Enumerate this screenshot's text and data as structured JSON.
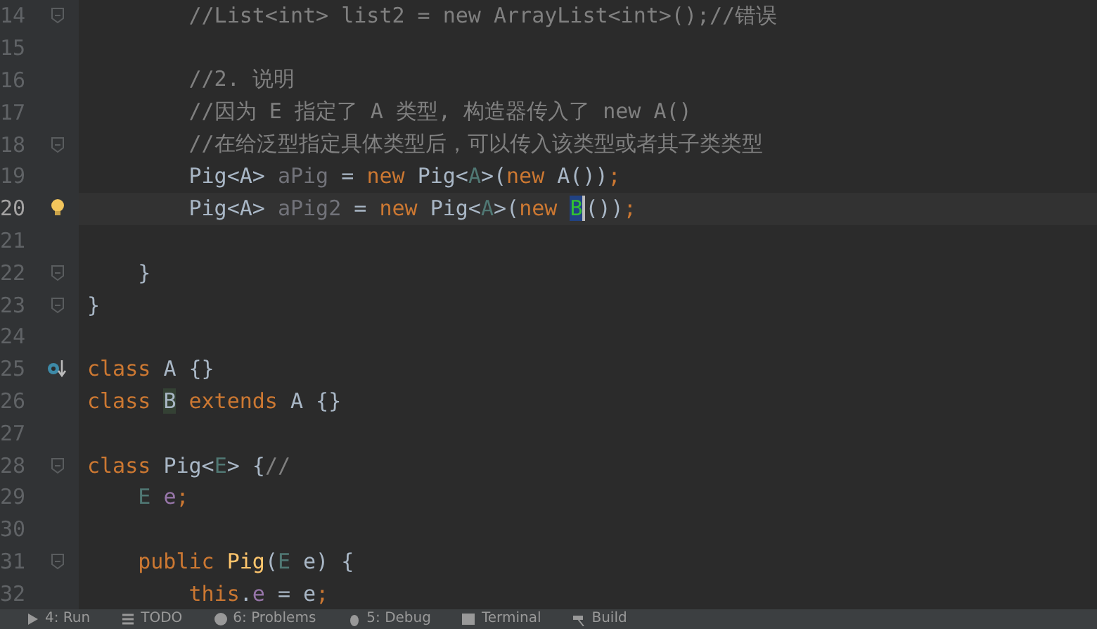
{
  "editor": {
    "lines": [
      {
        "number": "14",
        "current": false,
        "kind": "fold",
        "tokens": [
          {
            "text": "        //List<int> list2 = new ArrayList<int>();//错误",
            "kind": "comment"
          }
        ]
      },
      {
        "number": "15",
        "current": false
      },
      {
        "number": "16",
        "current": false,
        "tokens": [
          {
            "text": "        //2. 说明",
            "kind": "comment"
          }
        ]
      },
      {
        "number": "17",
        "current": false,
        "tokens": [
          {
            "text": "        //因为 E 指定了 A 类型, 构造器传入了 new A()",
            "kind": "comment"
          }
        ]
      },
      {
        "number": "18",
        "current": false,
        "kind": "fold",
        "tokens": [
          {
            "text": "        //在给泛型指定具体类型后，可以传入该类型或者其子类类型",
            "kind": "comment"
          }
        ]
      },
      {
        "number": "19",
        "current": false,
        "tokens": [
          {
            "text": "        Pig<A> ",
            "kind": "plain"
          },
          {
            "text": "aPig",
            "kind": "unused"
          },
          {
            "text": " = ",
            "kind": "plain"
          },
          {
            "text": "new ",
            "kind": "keyword"
          },
          {
            "text": "Pig<",
            "kind": "plain"
          },
          {
            "text": "A",
            "kind": "typeparam"
          },
          {
            "text": ">(",
            "kind": "plain"
          },
          {
            "text": "new ",
            "kind": "keyword"
          },
          {
            "text": "A())",
            "kind": "plain"
          },
          {
            "text": ";",
            "kind": "keyword"
          }
        ]
      },
      {
        "number": "20",
        "current": true,
        "kind": "bulb",
        "tokens": [
          {
            "text": "        Pig<A> ",
            "kind": "plain"
          },
          {
            "text": "aPig2",
            "kind": "unused"
          },
          {
            "text": " = ",
            "kind": "plain"
          },
          {
            "text": "new ",
            "kind": "keyword"
          },
          {
            "text": "Pig<",
            "kind": "plain"
          },
          {
            "text": "A",
            "kind": "typeparam"
          },
          {
            "text": ">(",
            "kind": "plain"
          },
          {
            "text": "new ",
            "kind": "keyword"
          },
          {
            "text": "B",
            "kind": "selected"
          },
          {
            "text": "())",
            "kind": "plain"
          },
          {
            "text": ";",
            "kind": "keyword"
          }
        ]
      },
      {
        "number": "21",
        "current": false
      },
      {
        "number": "22",
        "current": false,
        "kind": "fold",
        "tokens": [
          {
            "text": "    }",
            "kind": "plain"
          }
        ]
      },
      {
        "number": "23",
        "current": false,
        "kind": "fold",
        "tokens": [
          {
            "text": "}",
            "kind": "plain"
          }
        ]
      },
      {
        "number": "24",
        "current": false
      },
      {
        "number": "25",
        "current": false,
        "kind": "implemented",
        "tokens": [
          {
            "text": "class ",
            "kind": "keyword"
          },
          {
            "text": "A {}",
            "kind": "plain"
          }
        ]
      },
      {
        "number": "26",
        "current": false,
        "tokens": [
          {
            "text": "class ",
            "kind": "keyword"
          },
          {
            "text": "B",
            "kind": "usage"
          },
          {
            "text": " extends ",
            "kind": "keyword"
          },
          {
            "text": "A {}",
            "kind": "plain"
          }
        ]
      },
      {
        "number": "27",
        "current": false
      },
      {
        "number": "28",
        "current": false,
        "kind": "fold",
        "tokens": [
          {
            "text": "class ",
            "kind": "keyword"
          },
          {
            "text": "Pig<",
            "kind": "plain"
          },
          {
            "text": "E",
            "kind": "typeparam"
          },
          {
            "text": "> {",
            "kind": "plain"
          },
          {
            "text": "//",
            "kind": "comment"
          }
        ]
      },
      {
        "number": "29",
        "current": false,
        "tokens": [
          {
            "text": "    E ",
            "kind": "typeparam"
          },
          {
            "text": "e",
            "kind": "field"
          },
          {
            "text": ";",
            "kind": "keyword"
          }
        ]
      },
      {
        "number": "30",
        "current": false
      },
      {
        "number": "31",
        "current": false,
        "kind": "fold",
        "tokens": [
          {
            "text": "    public ",
            "kind": "keyword"
          },
          {
            "text": "Pig",
            "kind": "method"
          },
          {
            "text": "(",
            "kind": "plain"
          },
          {
            "text": "E ",
            "kind": "typeparam"
          },
          {
            "text": "e) {",
            "kind": "plain"
          }
        ]
      },
      {
        "number": "32",
        "current": false,
        "tokens": [
          {
            "text": "        this",
            "kind": "keyword"
          },
          {
            "text": ".",
            "kind": "plain"
          },
          {
            "text": "e",
            "kind": "field"
          },
          {
            "text": " = e",
            "kind": "plain"
          },
          {
            "text": ";",
            "kind": "keyword"
          }
        ]
      }
    ]
  },
  "tool_windows": [
    {
      "label": "4: Run"
    },
    {
      "label": "TODO"
    },
    {
      "label": "6: Problems"
    },
    {
      "label": "5: Debug"
    },
    {
      "label": "Terminal"
    },
    {
      "label": "Build"
    }
  ]
}
